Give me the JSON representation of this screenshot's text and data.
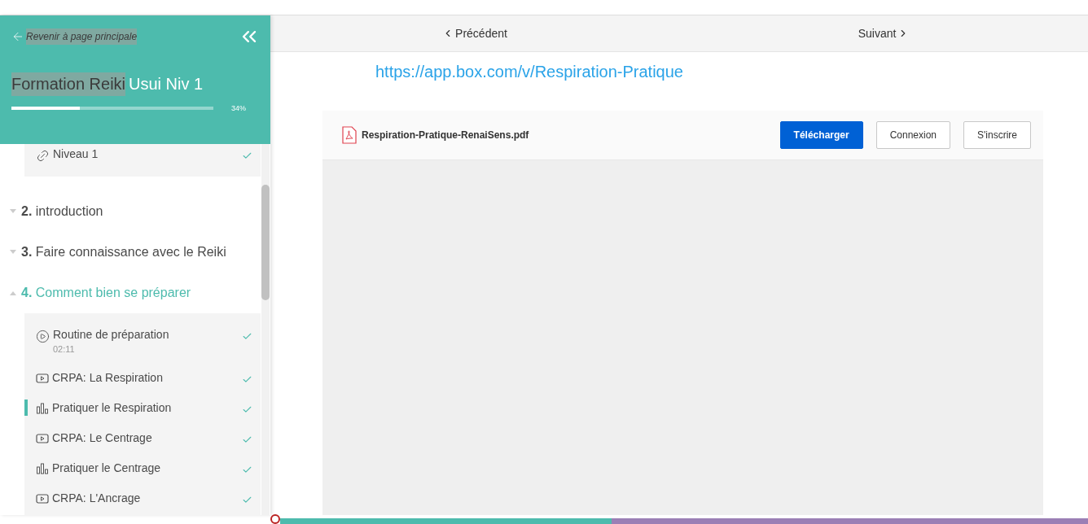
{
  "sidebar": {
    "back_link": "Revenir à page principale",
    "course_title_highlighted": "Formation Reiki",
    "course_title_rest": "Usui Niv 1",
    "progress": {
      "level": 0.34,
      "reading": "34%"
    },
    "partial_lesson": {
      "kind": "link",
      "title": "Niveau 1",
      "completed": true
    },
    "sections": [
      {
        "number": "2.",
        "title": "introduction",
        "expanded": false
      },
      {
        "number": "3.",
        "title": "Faire connaissance avec le Reiki",
        "expanded": false
      },
      {
        "number": "4.",
        "title": "Comment bien se préparer",
        "expanded": true,
        "lessons": [
          {
            "kind": "lecture",
            "title": "Routine de préparation",
            "duration": "02:11",
            "completed": true,
            "selected": false
          },
          {
            "kind": "video",
            "title": "CRPA: La Respiration",
            "completed": true,
            "selected": false
          },
          {
            "kind": "survey",
            "title": "Pratiquer le Respiration",
            "completed": true,
            "selected": true
          },
          {
            "kind": "video",
            "title": "CRPA: Le Centrage",
            "completed": true,
            "selected": false
          },
          {
            "kind": "survey",
            "title": "Pratiquer le Centrage",
            "completed": true,
            "selected": false
          },
          {
            "kind": "video",
            "title": "CRPA: L'Ancrage",
            "completed": true,
            "selected": false
          }
        ]
      }
    ]
  },
  "nav": {
    "previous": "Précédent",
    "next": "Suivant"
  },
  "content": {
    "link": "https://app.box.com/v/Respiration-Pratique",
    "viewer": {
      "file_name": "Respiration-Pratique-RenaiSens.pdf",
      "buttons": [
        {
          "label": "Télécharger",
          "kind": "primary"
        },
        {
          "label": "Connexion",
          "kind": "secondary"
        },
        {
          "label": "S'inscrire",
          "kind": "secondary"
        }
      ]
    }
  },
  "player": {
    "level": 0.41
  }
}
